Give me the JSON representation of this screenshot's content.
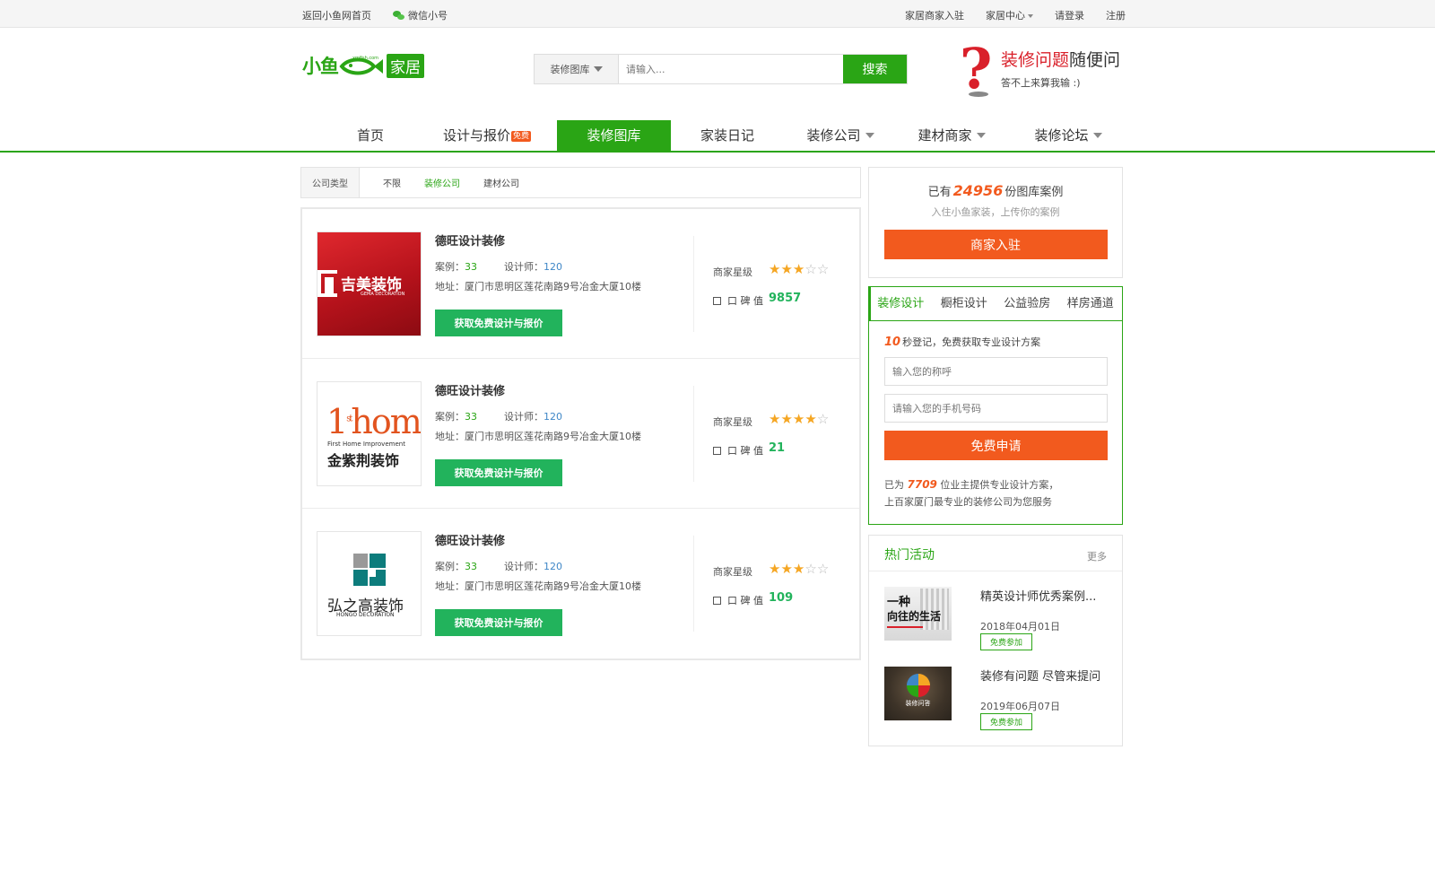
{
  "topbar": {
    "back_home": "返回小鱼网首页",
    "wechat": "微信小号",
    "merchant_join": "家居商家入驻",
    "home_center": "家居中心",
    "login": "请登录",
    "register": "注册"
  },
  "logo": {
    "part1": "小鱼",
    "part2": "家居",
    "fish_text": "xmfish.com"
  },
  "search": {
    "category": "装修图库",
    "placeholder": "请输入...",
    "button": "搜索"
  },
  "ask": {
    "headline_red": "装修问题",
    "headline_rest": "随便问",
    "sub": "答不上来算我输 :)"
  },
  "nav": {
    "items": [
      {
        "label": "首页"
      },
      {
        "label": "设计与报价",
        "badge": "免费"
      },
      {
        "label": "装修图库",
        "active": true
      },
      {
        "label": "家装日记"
      },
      {
        "label": "装修公司",
        "dropdown": true
      },
      {
        "label": "建材商家",
        "dropdown": true
      },
      {
        "label": "装修论坛",
        "dropdown": true
      }
    ]
  },
  "filter": {
    "label": "公司类型",
    "options": [
      "不限",
      "装修公司",
      "建材公司"
    ],
    "selected": "装修公司"
  },
  "companies": [
    {
      "name": "德旺设计装修",
      "cases_label": "案例：",
      "cases": "33",
      "designers_label": "设计师：",
      "designers": "120",
      "address": "地址：厦门市思明区莲花南路9号冶金大厦10楼",
      "button": "获取免费设计与报价",
      "star_label": "商家星级",
      "stars": 3,
      "reputation_label": "口 碑 值",
      "reputation": "9857",
      "logo_text": "吉美装饰",
      "logo_sub": "GEMA DECORATION"
    },
    {
      "name": "德旺设计装修",
      "cases_label": "案例：",
      "cases": "33",
      "designers_label": "设计师：",
      "designers": "120",
      "address": "地址：厦门市思明区莲花南路9号冶金大厦10楼",
      "button": "获取免费设计与报价",
      "star_label": "商家星级",
      "stars": 4,
      "reputation_label": "口 碑 值",
      "reputation": "21",
      "logo_text": "金紫荆装饰",
      "logo_sub": "First Home Improvement",
      "logo_big": "home",
      "logo_sup": "st",
      "logo_one": "1"
    },
    {
      "name": "德旺设计装修",
      "cases_label": "案例：",
      "cases": "33",
      "designers_label": "设计师：",
      "designers": "120",
      "address": "地址：厦门市思明区莲花南路9号冶金大厦10楼",
      "button": "获取免费设计与报价",
      "star_label": "商家星级",
      "stars": 3,
      "reputation_label": "口 碑 值",
      "reputation": "109",
      "logo_text": "弘之高装饰",
      "logo_sub": "HONGO DECORATION"
    }
  ],
  "side_cases": {
    "prefix": "已有",
    "count": "24956",
    "suffix": "份图库案例",
    "sub": "入住小鱼家装，上传你的案例",
    "button": "商家入驻"
  },
  "side_form": {
    "tabs": [
      "装修设计",
      "橱柜设计",
      "公益验房",
      "样房通道"
    ],
    "active_tab": "装修设计",
    "lead_num": "10",
    "lead_text": "秒登记，免费获取专业设计方案",
    "name_placeholder": "输入您的称呼",
    "phone_placeholder": "请输入您的手机号码",
    "button": "免费申请",
    "foot_prefix": "已为",
    "foot_num": "7709",
    "foot_line1_rest": "位业主提供专业设计方案，",
    "foot_line2": "上百家厦门最专业的装修公司为您服务"
  },
  "activities": {
    "title": "热门活动",
    "more": "更多",
    "items": [
      {
        "title": "精英设计师优秀案例...",
        "date": "2018年04月01日",
        "tag": "免费参加",
        "img_text1": "一种",
        "img_text2": "向往的生活"
      },
      {
        "title": "装修有问题 尽管来提问",
        "date": "2019年06月07日",
        "tag": "免费参加",
        "img_text1": "装修问答"
      }
    ]
  },
  "colors": {
    "brand_green": "#2aa515",
    "button_green": "#22b35c",
    "accent_orange": "#f25a1e",
    "star": "#f5a623"
  }
}
